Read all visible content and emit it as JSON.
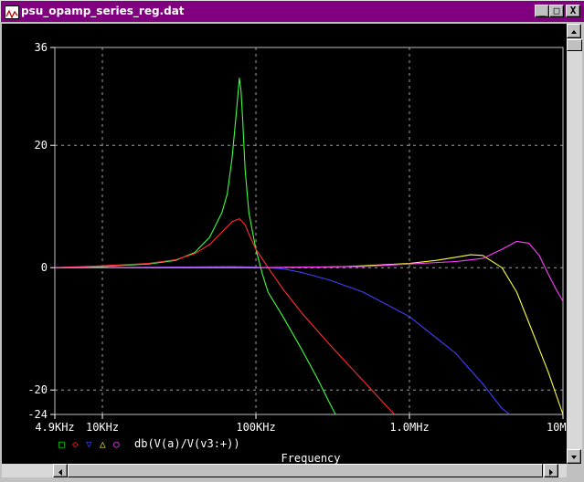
{
  "window": {
    "title": "psu_opamp_series_reg.dat",
    "minimize_glyph": "_",
    "maximize_glyph": "□",
    "close_glyph": "X"
  },
  "chart_data": {
    "type": "line",
    "xscale": "log",
    "xlim": [
      4900,
      10000000
    ],
    "ylim": [
      -24,
      36
    ],
    "xlabel": "Frequency",
    "ylabel": "",
    "x_ticks": [
      {
        "value": 4900,
        "label": "4.9KHz"
      },
      {
        "value": 10000,
        "label": "10KHz"
      },
      {
        "value": 100000,
        "label": "100KHz"
      },
      {
        "value": 1000000,
        "label": "1.0MHz"
      },
      {
        "value": 10000000,
        "label": "10MHz"
      }
    ],
    "y_ticks": [
      {
        "value": 36,
        "label": "36"
      },
      {
        "value": 20,
        "label": "20"
      },
      {
        "value": 0,
        "label": "0"
      },
      {
        "value": -20,
        "label": "-20"
      },
      {
        "value": -24,
        "label": "-24"
      }
    ],
    "grid": true,
    "legend_placement": "bottom-left",
    "legend_markers": [
      {
        "symbol": "□",
        "color": "#00ff00"
      },
      {
        "symbol": "◇",
        "color": "#ff2020"
      },
      {
        "symbol": "▽",
        "color": "#4040ff"
      },
      {
        "symbol": "△",
        "color": "#ffff40"
      },
      {
        "symbol": "○",
        "color": "#ff40ff"
      }
    ],
    "legend_text": "db(V(a)/V(v3:+))",
    "series": [
      {
        "color": "#40ff40",
        "x": [
          4900,
          10000,
          20000,
          30000,
          40000,
          50000,
          60000,
          65000,
          70000,
          75000,
          78000,
          80000,
          82000,
          85000,
          90000,
          100000,
          110000,
          120000,
          150000,
          200000,
          250000,
          300000,
          330000
        ],
        "y": [
          0,
          0.2,
          0.6,
          1.2,
          2.5,
          5,
          9,
          12,
          18,
          26,
          31,
          29,
          24,
          16,
          9,
          3,
          -1,
          -4,
          -8,
          -13.5,
          -18,
          -22,
          -24
        ]
      },
      {
        "color": "#ff3030",
        "x": [
          4900,
          10000,
          20000,
          30000,
          40000,
          50000,
          60000,
          70000,
          78000,
          85000,
          90000,
          100000,
          120000,
          150000,
          200000,
          300000,
          500000,
          700000,
          800000
        ],
        "y": [
          0,
          0.3,
          0.7,
          1.3,
          2.3,
          3.8,
          5.8,
          7.5,
          8,
          7,
          5.5,
          3,
          0,
          -3.5,
          -7.5,
          -12.5,
          -18.5,
          -22.5,
          -24
        ]
      },
      {
        "color": "#4040ff",
        "x": [
          4900,
          10000,
          30000,
          70000,
          100000,
          150000,
          200000,
          300000,
          500000,
          1000000,
          2000000,
          3000000,
          4000000,
          4500000
        ],
        "y": [
          0,
          0,
          0.1,
          0.2,
          0.1,
          -0.2,
          -0.8,
          -2,
          -4,
          -8,
          -14,
          -19,
          -23,
          -24
        ]
      },
      {
        "color": "#ffff40",
        "x": [
          4900,
          100000,
          300000,
          500000,
          1000000,
          1500000,
          2000000,
          2500000,
          3000000,
          4000000,
          5000000,
          6000000,
          8000000,
          10000000
        ],
        "y": [
          0,
          0,
          0.1,
          0.3,
          0.7,
          1.2,
          1.7,
          2.1,
          2,
          0,
          -4,
          -9,
          -17,
          -24
        ]
      },
      {
        "color": "#ff40ff",
        "x": [
          4900,
          100000,
          500000,
          1000000,
          2000000,
          3000000,
          4000000,
          5000000,
          6000000,
          7000000,
          8000000,
          9000000,
          10000000
        ],
        "y": [
          0,
          0,
          0.2,
          0.6,
          1,
          1.5,
          3,
          4.3,
          4,
          2,
          -1,
          -3.5,
          -5.5
        ]
      }
    ]
  }
}
